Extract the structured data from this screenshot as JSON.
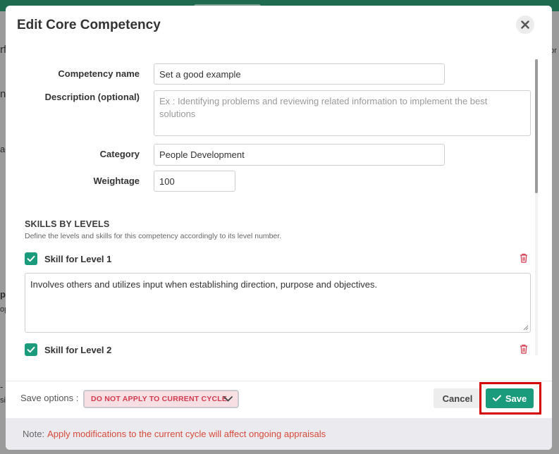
{
  "background": {
    "fragments": [
      "rf",
      "ne",
      "ag",
      "pl",
      "op",
      "- c",
      "si",
      "pr"
    ]
  },
  "modal": {
    "title": "Edit Core Competency"
  },
  "form": {
    "competency_name": {
      "label": "Competency name",
      "value": "Set a good example"
    },
    "description": {
      "label": "Description (optional)",
      "placeholder": "Ex : Identifying problems and reviewing related information to implement the best solutions"
    },
    "category": {
      "label": "Category",
      "value": "People Development"
    },
    "weightage": {
      "label": "Weightage",
      "value": "100"
    }
  },
  "skills": {
    "title": "SKILLS BY LEVELS",
    "subtitle": "Define the levels and skills for this competency accordingly to its level number.",
    "levels": [
      {
        "label": "Skill for Level 1",
        "checked": true,
        "text": "Involves others and utilizes input when establishing direction, purpose and objectives."
      },
      {
        "label": "Skill for Level 2",
        "checked": true,
        "text": ""
      }
    ]
  },
  "footer": {
    "save_options_label": "Save options :",
    "save_option_selected": "DO NOT APPLY TO CURRENT CYCLE",
    "cancel_label": "Cancel",
    "save_label": "Save"
  },
  "note": {
    "prefix": "Note:",
    "text": "Apply modifications to the current cycle will affect ongoing appraisals"
  },
  "colors": {
    "accent": "#1a9b7b",
    "danger": "#d23a4d",
    "highlight": "#d40000"
  },
  "icons": {
    "close": "close-icon",
    "check": "check-icon",
    "trash": "trash-icon",
    "dropdown": "chevron-down-icon"
  }
}
